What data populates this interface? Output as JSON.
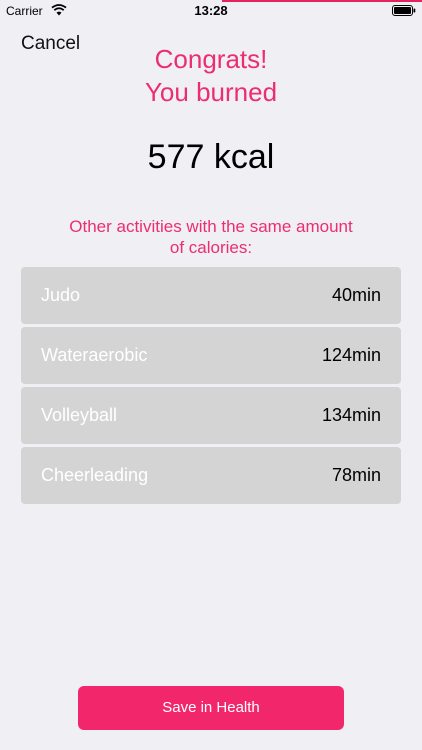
{
  "status_bar": {
    "carrier": "Carrier",
    "time": "13:28"
  },
  "nav": {
    "cancel_label": "Cancel"
  },
  "headline": {
    "line1": "Congrats!",
    "line2": "You burned"
  },
  "calories": {
    "value": "577 kcal"
  },
  "subtitle": "Other activities with the same amount of calories:",
  "activities": [
    {
      "name": "Judo",
      "duration": "40min"
    },
    {
      "name": "Wateraerobic",
      "duration": "124min"
    },
    {
      "name": "Volleyball",
      "duration": "134min"
    },
    {
      "name": "Cheerleading",
      "duration": "78min"
    }
  ],
  "actions": {
    "save_label": "Save in Health"
  },
  "colors": {
    "accent": "#EC2D74",
    "button": "#F2266A",
    "row_bg": "#D4D4D4",
    "page_bg": "#EFEFF4"
  },
  "icons": {
    "wifi": "wifi-icon",
    "battery": "battery-icon"
  }
}
